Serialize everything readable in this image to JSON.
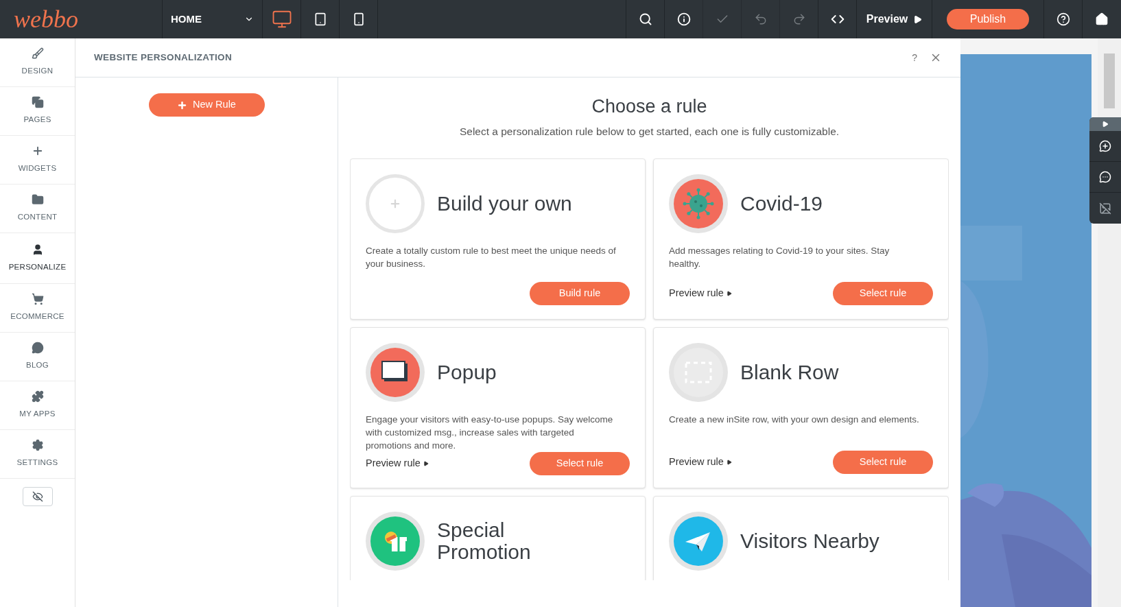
{
  "topbar": {
    "logo": "webbo",
    "page_select": {
      "value": "HOME"
    },
    "devices": [
      {
        "kind": "desktop",
        "selected": true
      },
      {
        "kind": "tablet",
        "selected": false
      },
      {
        "kind": "phone",
        "selected": false
      }
    ],
    "tools": [
      {
        "kind": "search",
        "disabled": false
      },
      {
        "kind": "info",
        "disabled": false
      },
      {
        "kind": "check",
        "disabled": true
      },
      {
        "kind": "undo",
        "disabled": true
      },
      {
        "kind": "redo",
        "disabled": true
      },
      {
        "kind": "code",
        "disabled": false
      }
    ],
    "preview": "Preview",
    "publish": "Publish"
  },
  "sidebar": {
    "items": [
      {
        "kind": "brush",
        "label": "DESIGN",
        "selected": false
      },
      {
        "kind": "pages",
        "label": "PAGES",
        "selected": false
      },
      {
        "kind": "plus",
        "label": "WIDGETS",
        "selected": false
      },
      {
        "kind": "folder",
        "label": "CONTENT",
        "selected": false
      },
      {
        "kind": "person",
        "label": "PERSONALIZE",
        "selected": true
      },
      {
        "kind": "cart",
        "label": "ECOMMERCE",
        "selected": false
      },
      {
        "kind": "chat",
        "label": "BLOG",
        "selected": false
      },
      {
        "kind": "puzzle",
        "label": "MY APPS",
        "selected": false
      },
      {
        "kind": "gear",
        "label": "SETTINGS",
        "selected": false
      }
    ]
  },
  "panel": {
    "title": "WEBSITE PERSONALIZATION",
    "help": "?",
    "new_rule": "New Rule",
    "heading": "Choose a rule",
    "subtitle": "Select a personalization rule below to get started, each one is fully customizable.",
    "rules": [
      {
        "kind": "custom",
        "title": "Build your own",
        "description": "Create a totally custom rule to best meet the unique needs of your business.",
        "button": "Build rule"
      },
      {
        "kind": "virus",
        "title": "Covid-19",
        "description": "Add messages relating to Covid-19 to your sites. Stay healthy.",
        "preview": "Preview rule",
        "button": "Select rule"
      },
      {
        "kind": "popup",
        "title": "Popup",
        "description": "Engage your visitors with easy-to-use popups. Say welcome with customized msg., increase sales with targeted promotions and more.",
        "preview": "Preview rule",
        "button": "Select rule"
      },
      {
        "kind": "blank",
        "title": "Blank Row",
        "description": "Create a new inSite row, with your own design and elements.",
        "preview": "Preview rule",
        "button": "Select rule"
      },
      {
        "kind": "promotion",
        "title": "Special Promotion"
      },
      {
        "kind": "plane",
        "title": "Visitors Nearby"
      }
    ]
  }
}
